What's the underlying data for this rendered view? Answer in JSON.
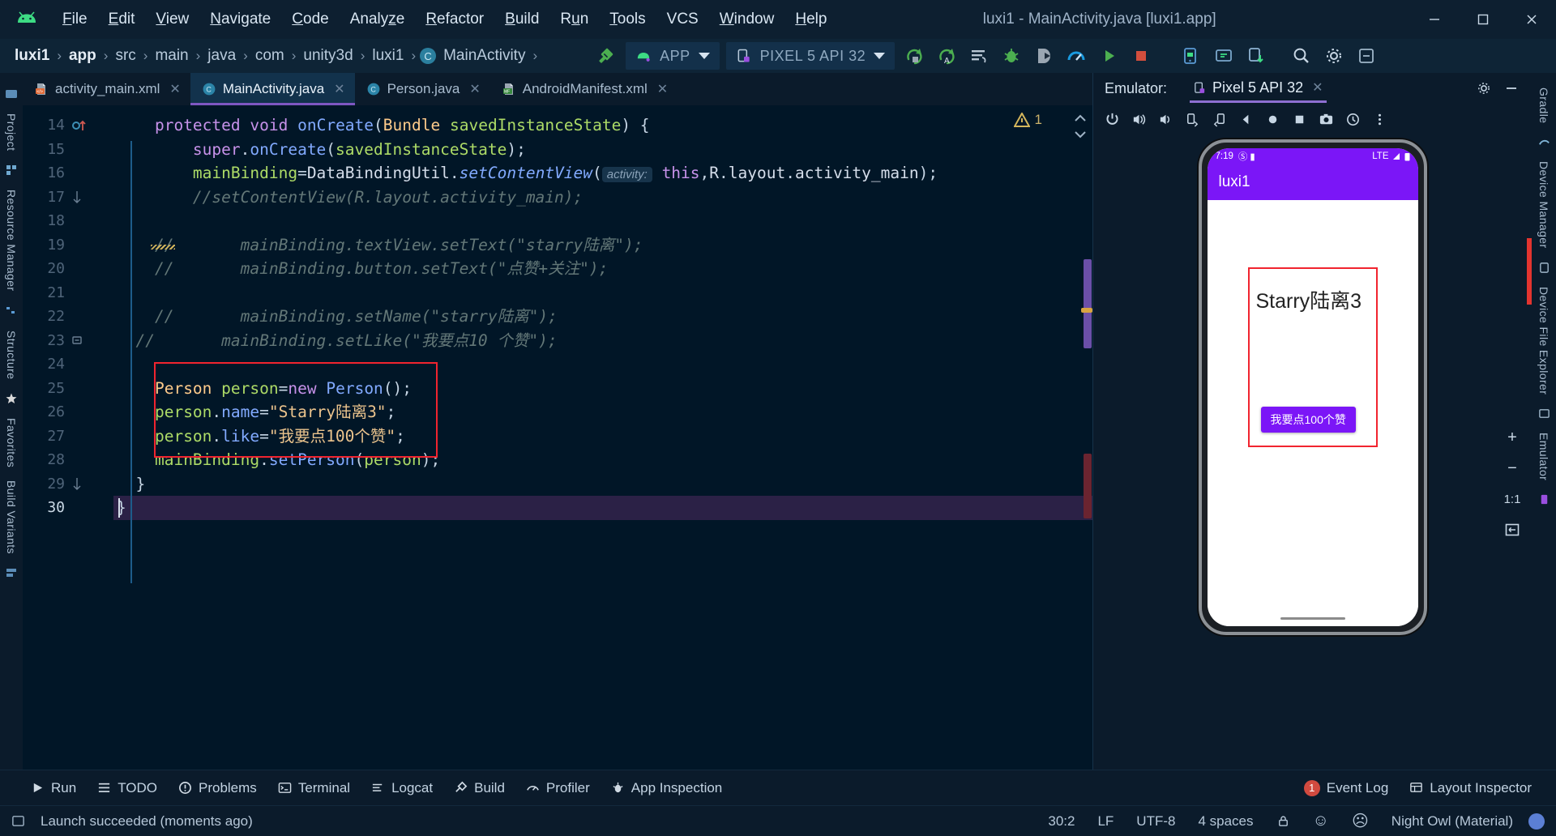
{
  "window": {
    "title": "luxi1 - MainActivity.java [luxi1.app]",
    "minimize": "—",
    "maximize": "❐",
    "close": "✕"
  },
  "menu": {
    "items": [
      {
        "label": "File",
        "mnemonic": "F"
      },
      {
        "label": "Edit",
        "mnemonic": "E"
      },
      {
        "label": "View",
        "mnemonic": "V"
      },
      {
        "label": "Navigate",
        "mnemonic": "N"
      },
      {
        "label": "Code",
        "mnemonic": "C"
      },
      {
        "label": "Analyze",
        "mnemonic": "z"
      },
      {
        "label": "Refactor",
        "mnemonic": "R"
      },
      {
        "label": "Build",
        "mnemonic": "B"
      },
      {
        "label": "Run",
        "mnemonic": "u"
      },
      {
        "label": "Tools",
        "mnemonic": "T"
      },
      {
        "label": "VCS",
        "mnemonic": "V"
      },
      {
        "label": "Window",
        "mnemonic": "W"
      },
      {
        "label": "Help",
        "mnemonic": "H"
      }
    ]
  },
  "breadcrumb": {
    "items": [
      "luxi1",
      "app",
      "src",
      "main",
      "java",
      "com",
      "unity3d",
      "luxi1",
      "MainActivity"
    ],
    "separator": "›"
  },
  "toolbar": {
    "run_config": "APP",
    "device": "PIXEL 5 API 32",
    "icons": [
      "hammer-icon",
      "run-icon",
      "apply-changes-icon",
      "apply-code-changes-icon",
      "rerun-icon",
      "debug-icon",
      "run-with-coverage-icon",
      "profiler-icon",
      "attach-debugger-icon",
      "avd-manager-icon",
      "sdk-manager-icon",
      "device-manager-icon",
      "search-icon",
      "settings-icon",
      "notifications-icon"
    ],
    "stop_label": "■"
  },
  "tabs": [
    {
      "label": "activity_main.xml",
      "icon": "xml-file-icon",
      "active": false,
      "close": "✕"
    },
    {
      "label": "MainActivity.java",
      "icon": "java-class-icon",
      "active": true,
      "close": "✕"
    },
    {
      "label": "Person.java",
      "icon": "java-class-icon",
      "active": false,
      "close": "✕"
    },
    {
      "label": "AndroidManifest.xml",
      "icon": "manifest-file-icon",
      "active": false,
      "close": "✕"
    }
  ],
  "left_rail": [
    "Project",
    "Resource Manager",
    "Structure",
    "Favorites",
    "Build Variants"
  ],
  "right_rail": [
    "Gradle",
    "Device Manager",
    "Device File Explorer",
    "Emulator"
  ],
  "editor": {
    "warning_count": "1",
    "caret_position": "30:2",
    "lines": [
      {
        "num": "14",
        "tokens": [
          {
            "t": "    ",
            "c": "pun"
          },
          {
            "t": "protected",
            "c": "kw"
          },
          {
            "t": " ",
            "c": "pun"
          },
          {
            "t": "void",
            "c": "kw"
          },
          {
            "t": " ",
            "c": "pun"
          },
          {
            "t": "onCreate",
            "c": "mth"
          },
          {
            "t": "(",
            "c": "pun"
          },
          {
            "t": "Bundle",
            "c": "typ"
          },
          {
            "t": " ",
            "c": "pun"
          },
          {
            "t": "savedInstanceState",
            "c": "var"
          },
          {
            "t": ") {",
            "c": "pun"
          }
        ]
      },
      {
        "num": "15",
        "tokens": [
          {
            "t": "        ",
            "c": "pun"
          },
          {
            "t": "super",
            "c": "kw"
          },
          {
            "t": ".",
            "c": "pun"
          },
          {
            "t": "onCreate",
            "c": "mth"
          },
          {
            "t": "(",
            "c": "pun"
          },
          {
            "t": "savedInstanceState",
            "c": "var"
          },
          {
            "t": ");",
            "c": "pun"
          }
        ]
      },
      {
        "num": "16",
        "tokens": [
          {
            "t": "        ",
            "c": "pun"
          },
          {
            "t": "mainBinding",
            "c": "var"
          },
          {
            "t": "=",
            "c": "pun"
          },
          {
            "t": "DataBindingUtil",
            "c": "id"
          },
          {
            "t": ".",
            "c": "pun"
          },
          {
            "t": "setContentView",
            "c": "mthi"
          },
          {
            "t": "(",
            "c": "pun"
          },
          {
            "t": "activity:",
            "c": "hint"
          },
          {
            "t": " ",
            "c": "pun"
          },
          {
            "t": "this",
            "c": "kw"
          },
          {
            "t": ",",
            "c": "pun"
          },
          {
            "t": "R",
            "c": "id"
          },
          {
            "t": ".",
            "c": "pun"
          },
          {
            "t": "layout",
            "c": "id"
          },
          {
            "t": ".",
            "c": "pun"
          },
          {
            "t": "activity_main",
            "c": "id"
          },
          {
            "t": ");",
            "c": "pun"
          }
        ]
      },
      {
        "num": "17",
        "tokens": [
          {
            "t": "        ",
            "c": "pun"
          },
          {
            "t": "//setContentView(R.layout.activity_main);",
            "c": "cmt"
          }
        ]
      },
      {
        "num": "18",
        "tokens": []
      },
      {
        "num": "19",
        "tokens": [
          {
            "t": "    ",
            "c": "pun"
          },
          {
            "t": "//",
            "c": "cmt"
          },
          {
            "t": "       mainBinding.textView.setText(\"starry陆离\");",
            "c": "cmt"
          }
        ]
      },
      {
        "num": "20",
        "tokens": [
          {
            "t": "    ",
            "c": "pun"
          },
          {
            "t": "//",
            "c": "cmt"
          },
          {
            "t": "       mainBinding.button.setText(\"点赞+关注\");",
            "c": "cmt"
          }
        ]
      },
      {
        "num": "21",
        "tokens": []
      },
      {
        "num": "22",
        "tokens": [
          {
            "t": "    ",
            "c": "pun"
          },
          {
            "t": "//",
            "c": "cmt"
          },
          {
            "t": "       mainBinding.setName(\"starry陆离\");",
            "c": "cmt"
          }
        ]
      },
      {
        "num": "23",
        "tokens": [
          {
            "t": "  ",
            "c": "pun"
          },
          {
            "t": "//",
            "c": "cmt"
          },
          {
            "t": "       mainBinding.setLike(\"我要点10 个赞\");",
            "c": "cmt"
          }
        ]
      },
      {
        "num": "24",
        "tokens": []
      },
      {
        "num": "25",
        "tokens": [
          {
            "t": "    ",
            "c": "pun"
          },
          {
            "t": "Person",
            "c": "typ"
          },
          {
            "t": " ",
            "c": "pun"
          },
          {
            "t": "person",
            "c": "var"
          },
          {
            "t": "=",
            "c": "pun"
          },
          {
            "t": "new",
            "c": "kw"
          },
          {
            "t": " ",
            "c": "pun"
          },
          {
            "t": "Person",
            "c": "mth"
          },
          {
            "t": "();",
            "c": "pun"
          }
        ]
      },
      {
        "num": "26",
        "tokens": [
          {
            "t": "    ",
            "c": "pun"
          },
          {
            "t": "person",
            "c": "var"
          },
          {
            "t": ".",
            "c": "pun"
          },
          {
            "t": "name",
            "c": "mth"
          },
          {
            "t": "=",
            "c": "pun"
          },
          {
            "t": "\"Starry陆离3\"",
            "c": "str"
          },
          {
            "t": ";",
            "c": "pun"
          }
        ]
      },
      {
        "num": "27",
        "tokens": [
          {
            "t": "    ",
            "c": "pun"
          },
          {
            "t": "person",
            "c": "var"
          },
          {
            "t": ".",
            "c": "pun"
          },
          {
            "t": "like",
            "c": "mth"
          },
          {
            "t": "=",
            "c": "pun"
          },
          {
            "t": "\"我要点100个赞\"",
            "c": "str"
          },
          {
            "t": ";",
            "c": "pun"
          }
        ]
      },
      {
        "num": "28",
        "tokens": [
          {
            "t": "    ",
            "c": "pun"
          },
          {
            "t": "mainBinding",
            "c": "var"
          },
          {
            "t": ".",
            "c": "pun"
          },
          {
            "t": "setPerson",
            "c": "mth"
          },
          {
            "t": "(",
            "c": "pun"
          },
          {
            "t": "person",
            "c": "var"
          },
          {
            "t": ");",
            "c": "pun"
          }
        ]
      },
      {
        "num": "29",
        "tokens": [
          {
            "t": "  }",
            "c": "pun"
          }
        ]
      },
      {
        "num": "30",
        "tokens": [
          {
            "t": "}",
            "c": "pun"
          }
        ]
      }
    ]
  },
  "emulator": {
    "panel_label": "Emulator:",
    "tab_label": "Pixel 5 API 32",
    "tab_close": "✕",
    "settings_icon": "gear-icon",
    "minimize_icon": "minimize-icon",
    "controls": [
      "power-icon",
      "volume-up-icon",
      "volume-down-icon",
      "rotate-left-icon",
      "rotate-right-icon",
      "back-icon",
      "home-icon",
      "overview-icon",
      "screenshot-icon",
      "history-icon",
      "more-icon"
    ],
    "zoom_controls": [
      "zoom-in",
      "zoom-out",
      "zoom-actual",
      "zoom-fit"
    ],
    "zoom_in": "+",
    "zoom_out": "−",
    "zoom_actual": "1:1",
    "device": {
      "status_time": "7:19",
      "status_icons_left": "Ⓢ",
      "status_network": "LTE",
      "app_title": "luxi1",
      "text_view": "Starry陆离3",
      "button_label": "我要点100个赞"
    }
  },
  "tool_windows": {
    "left": [
      {
        "label": "Run",
        "icon": "run-icon"
      },
      {
        "label": "TODO",
        "icon": "todo-icon"
      },
      {
        "label": "Problems",
        "icon": "problems-icon"
      },
      {
        "label": "Terminal",
        "icon": "terminal-icon"
      },
      {
        "label": "Logcat",
        "icon": "logcat-icon"
      },
      {
        "label": "Build",
        "icon": "build-icon"
      },
      {
        "label": "Profiler",
        "icon": "profiler-icon"
      },
      {
        "label": "App Inspection",
        "icon": "app-inspection-icon"
      }
    ],
    "right": [
      {
        "label": "Event Log",
        "icon": "event-log-icon",
        "badge": "1"
      },
      {
        "label": "Layout Inspector",
        "icon": "layout-inspector-icon",
        "badge": ""
      }
    ]
  },
  "status_bar": {
    "message": "Launch succeeded (moments ago)",
    "caret": "30:2",
    "line_separator": "LF",
    "encoding": "UTF-8",
    "indent": "4 spaces",
    "theme": "Night Owl (Material)",
    "lock_icon": "lock-icon",
    "happy_icon": "☺",
    "sad_icon": "☹"
  },
  "colors": {
    "accent_purple": "#7e57c2",
    "android_green": "#3ddc84",
    "highlight_red": "#f1242f",
    "app_purple": "#7b16f7",
    "editor_bg": "#011627",
    "panel_bg": "#0b1b2b"
  }
}
